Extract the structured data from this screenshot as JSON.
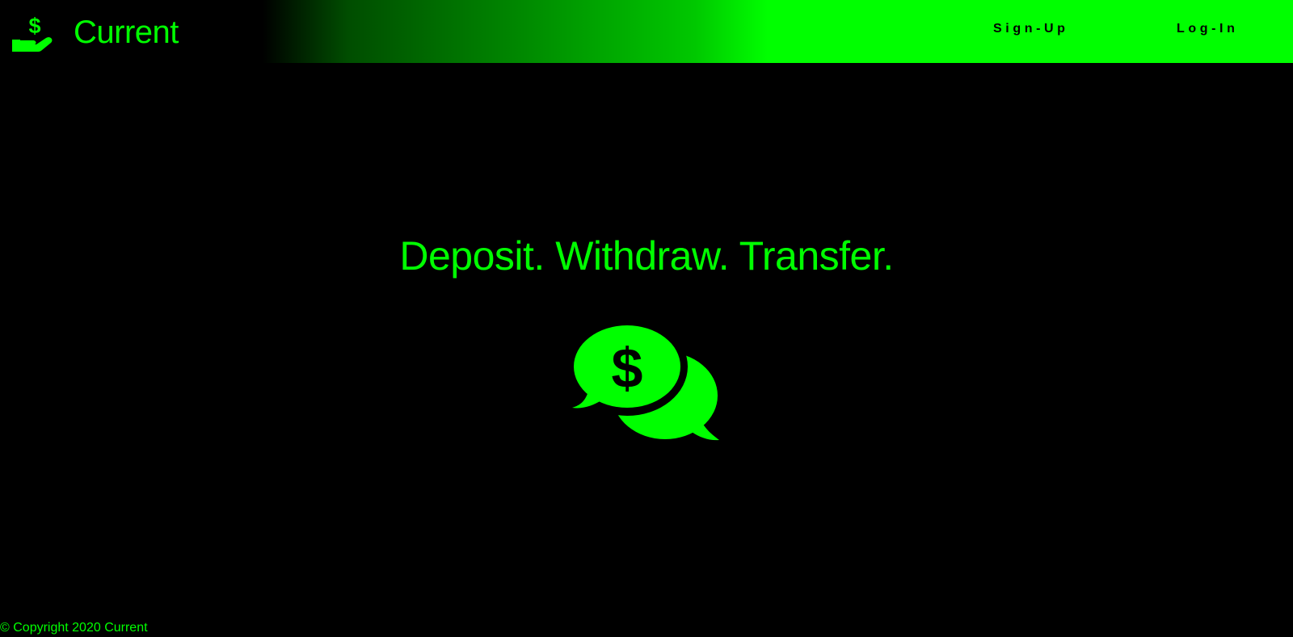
{
  "brand": {
    "name": "Current",
    "icon": "hand-holding-dollar-icon"
  },
  "nav": {
    "signup_label": "Sign-Up",
    "login_label": "Log-In"
  },
  "hero": {
    "title": "Deposit. Withdraw. Transfer.",
    "icon": "comments-dollar-icon"
  },
  "footer": {
    "copyright": "© Copyright 2020 Current"
  },
  "colors": {
    "accent": "#00ff00",
    "background": "#000000",
    "nav_text": "#000000"
  }
}
